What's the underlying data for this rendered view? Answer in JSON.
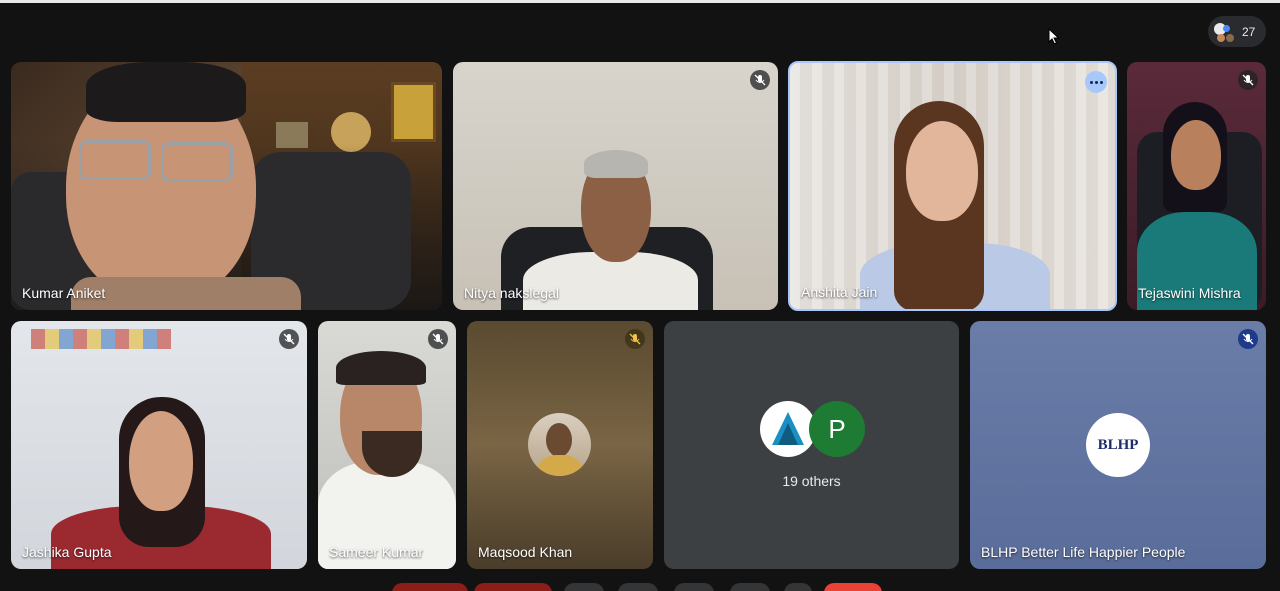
{
  "participants_count": "27",
  "tiles": [
    {
      "name": "Kumar Aniket"
    },
    {
      "name": "Nitya nakslegal"
    },
    {
      "name": "Anshita Jain"
    },
    {
      "name": "Tejaswini Mishra"
    },
    {
      "name": "Jashika Gupta"
    },
    {
      "name": "Sameer Kumar"
    },
    {
      "name": "Maqsood Khan"
    },
    {
      "name": "",
      "others_label": "19 others",
      "avatar_letter": "P"
    },
    {
      "name": "BLHP Better Life Happier People",
      "logo_text": "BLHP"
    }
  ],
  "colors": {
    "background": "#121212",
    "tile": "#3c4043",
    "active_border": "#a8c7fa",
    "avatar_green": "#1e7b34",
    "end_call": "#ea4335"
  },
  "icons": [
    "mic-off-icon",
    "more-options-icon",
    "people-icon",
    "cursor-icon"
  ]
}
